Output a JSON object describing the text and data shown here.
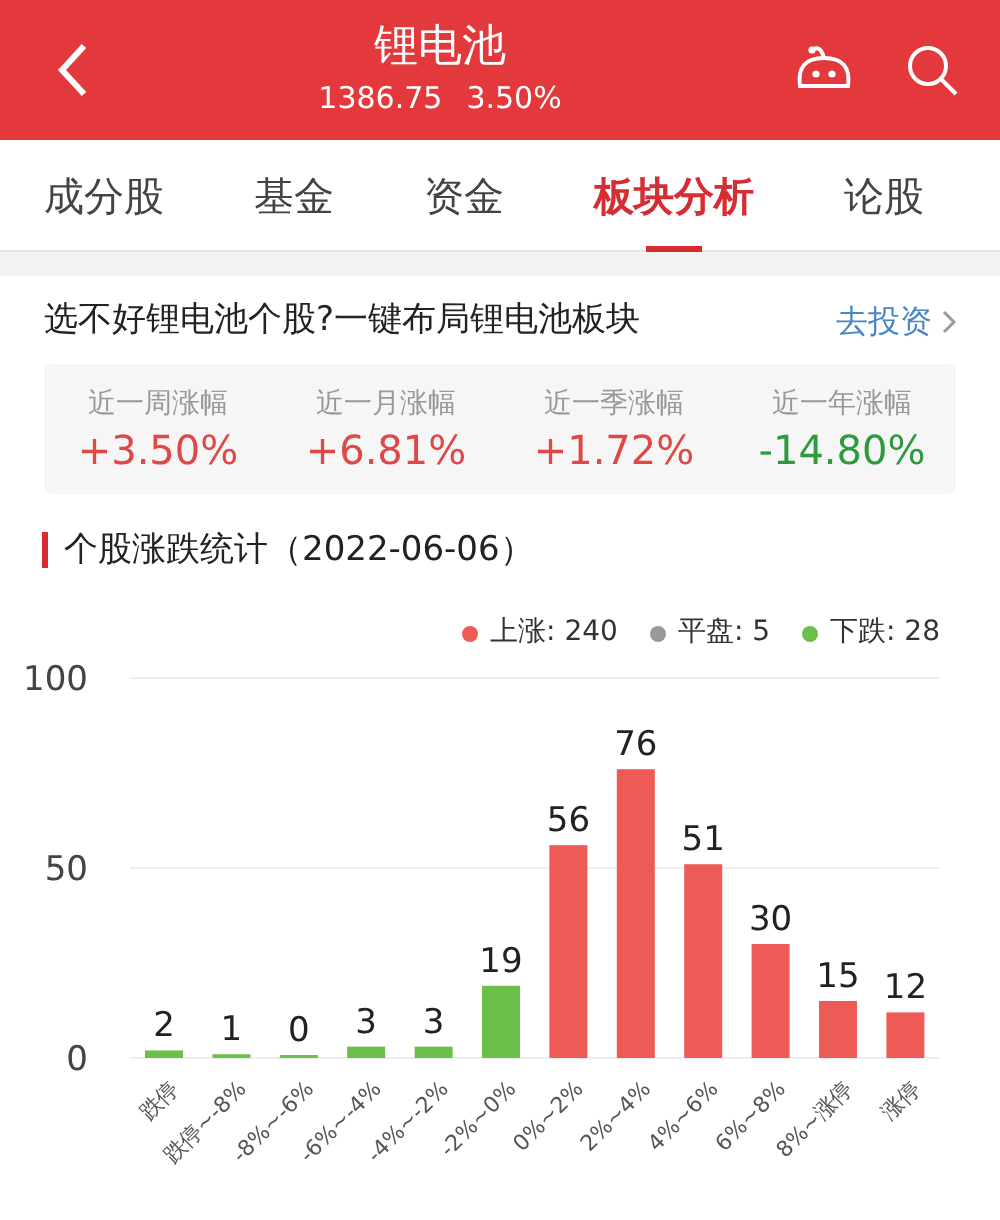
{
  "header": {
    "title": "锂电池",
    "price": "1386.75",
    "change": "3.50%"
  },
  "tabs": [
    {
      "label": "成分股",
      "selected": false
    },
    {
      "label": "基金",
      "selected": false
    },
    {
      "label": "资金",
      "selected": false
    },
    {
      "label": "板块分析",
      "selected": true
    },
    {
      "label": "论股",
      "selected": false
    }
  ],
  "promo": {
    "text": "选不好锂电池个股?一键布局锂电池板块",
    "link": "去投资"
  },
  "stats": [
    {
      "label": "近一周涨幅",
      "value": "+3.50%",
      "color": "#e04848"
    },
    {
      "label": "近一月涨幅",
      "value": "+6.81%",
      "color": "#e04848"
    },
    {
      "label": "近一季涨幅",
      "value": "+1.72%",
      "color": "#e04848"
    },
    {
      "label": "近一年涨幅",
      "value": "-14.80%",
      "color": "#2e9a3e"
    }
  ],
  "section": {
    "title": "个股涨跌统计（2022-06-06）"
  },
  "legend": [
    {
      "label": "上涨: 240",
      "color": "#ee5b57"
    },
    {
      "label": "平盘: 5",
      "color": "#999999"
    },
    {
      "label": "下跌: 28",
      "color": "#6cc04a"
    }
  ],
  "chart_data": {
    "type": "bar",
    "categories": [
      "跌停",
      "跌停~-8%",
      "-8%~-6%",
      "-6%~-4%",
      "-4%~-2%",
      "-2%~0%",
      "0%~2%",
      "2%~4%",
      "4%~6%",
      "6%~8%",
      "8%~涨停",
      "涨停"
    ],
    "series": [
      {
        "color": "#6cc04a",
        "values": [
          2,
          1,
          0,
          3,
          3,
          19,
          null,
          null,
          null,
          null,
          null,
          null
        ]
      },
      {
        "color": "#ee5b57",
        "values": [
          null,
          null,
          null,
          null,
          null,
          null,
          56,
          76,
          51,
          30,
          15,
          12
        ]
      }
    ],
    "ylim": [
      0,
      100
    ],
    "yticks": [
      0,
      50,
      100
    ],
    "data_labels": true
  }
}
